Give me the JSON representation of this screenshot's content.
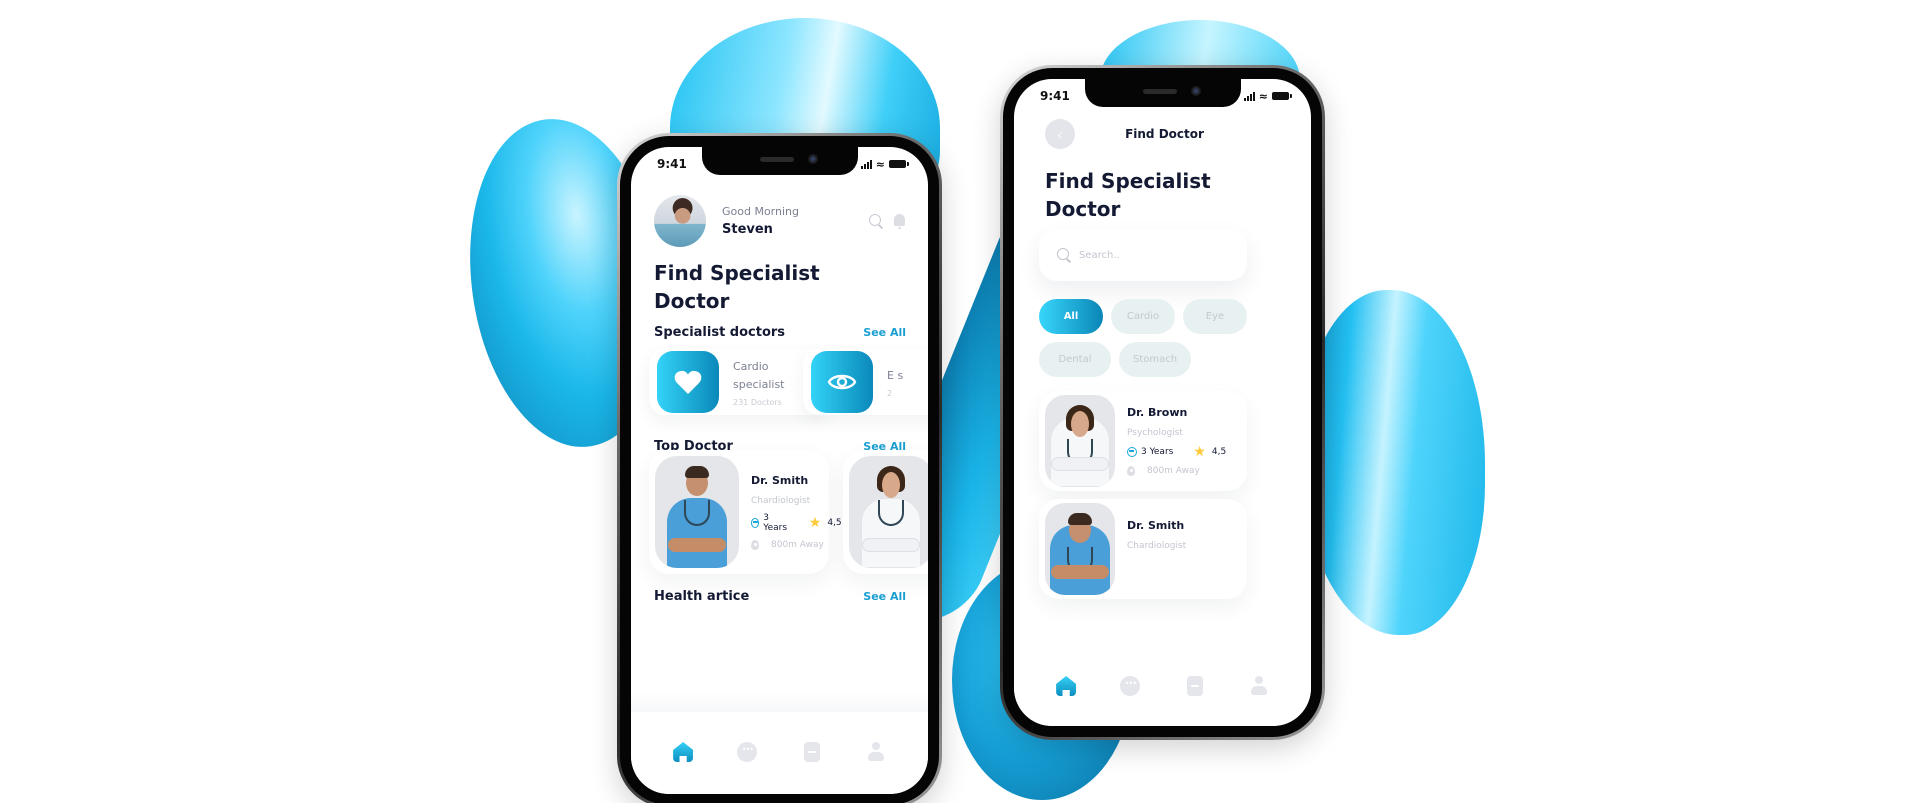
{
  "status_bar": {
    "time": "9:41"
  },
  "home_screen": {
    "greeting": "Good Morning",
    "user_name": "Steven",
    "title": "Find Specialist Doctor",
    "sections": {
      "specialists": {
        "title": "Specialist doctors",
        "see_all": "See All"
      },
      "top_doctor": {
        "title": "Top Doctor",
        "see_all": "See All"
      },
      "health_article": {
        "title": "Health artice",
        "see_all": "See All"
      }
    },
    "specialist_cards": [
      {
        "name": "Cardio specialist",
        "count": "231 Doctors",
        "icon": "heart-icon"
      },
      {
        "name": "E s",
        "count": "2",
        "icon": "eye-icon"
      }
    ],
    "top_doctors": [
      {
        "name": "Dr. Smith",
        "specialty": "Chardiologist",
        "experience": "3 Years",
        "rating": "4,5",
        "distance": "800m Away"
      }
    ],
    "nav": [
      "home-icon",
      "chat-icon",
      "calendar-icon",
      "profile-icon"
    ]
  },
  "find_screen": {
    "header_title": "Find Doctor",
    "title": "Find Specialist Doctor",
    "search_placeholder": "Search..",
    "categories": [
      {
        "label": "All",
        "active": true
      },
      {
        "label": "Cardio",
        "active": false
      },
      {
        "label": "Eye",
        "active": false
      },
      {
        "label": "Dental",
        "active": false
      },
      {
        "label": "Stomach",
        "active": false
      }
    ],
    "doctors": [
      {
        "name": "Dr. Brown",
        "specialty": "Psychologist",
        "experience": "3 Years",
        "rating": "4,5",
        "distance": "800m Away"
      },
      {
        "name": "Dr. Smith",
        "specialty": "Chardiologist"
      }
    ],
    "nav": [
      "home-icon",
      "chat-icon",
      "calendar-icon",
      "profile-icon"
    ]
  },
  "colors": {
    "accent_start": "#33d3f7",
    "accent_end": "#0a89ba",
    "see_all": "#1a9fd0",
    "star": "#ffc93c",
    "text_dark": "#141a33",
    "chip_bg": "#e8f1f1"
  }
}
